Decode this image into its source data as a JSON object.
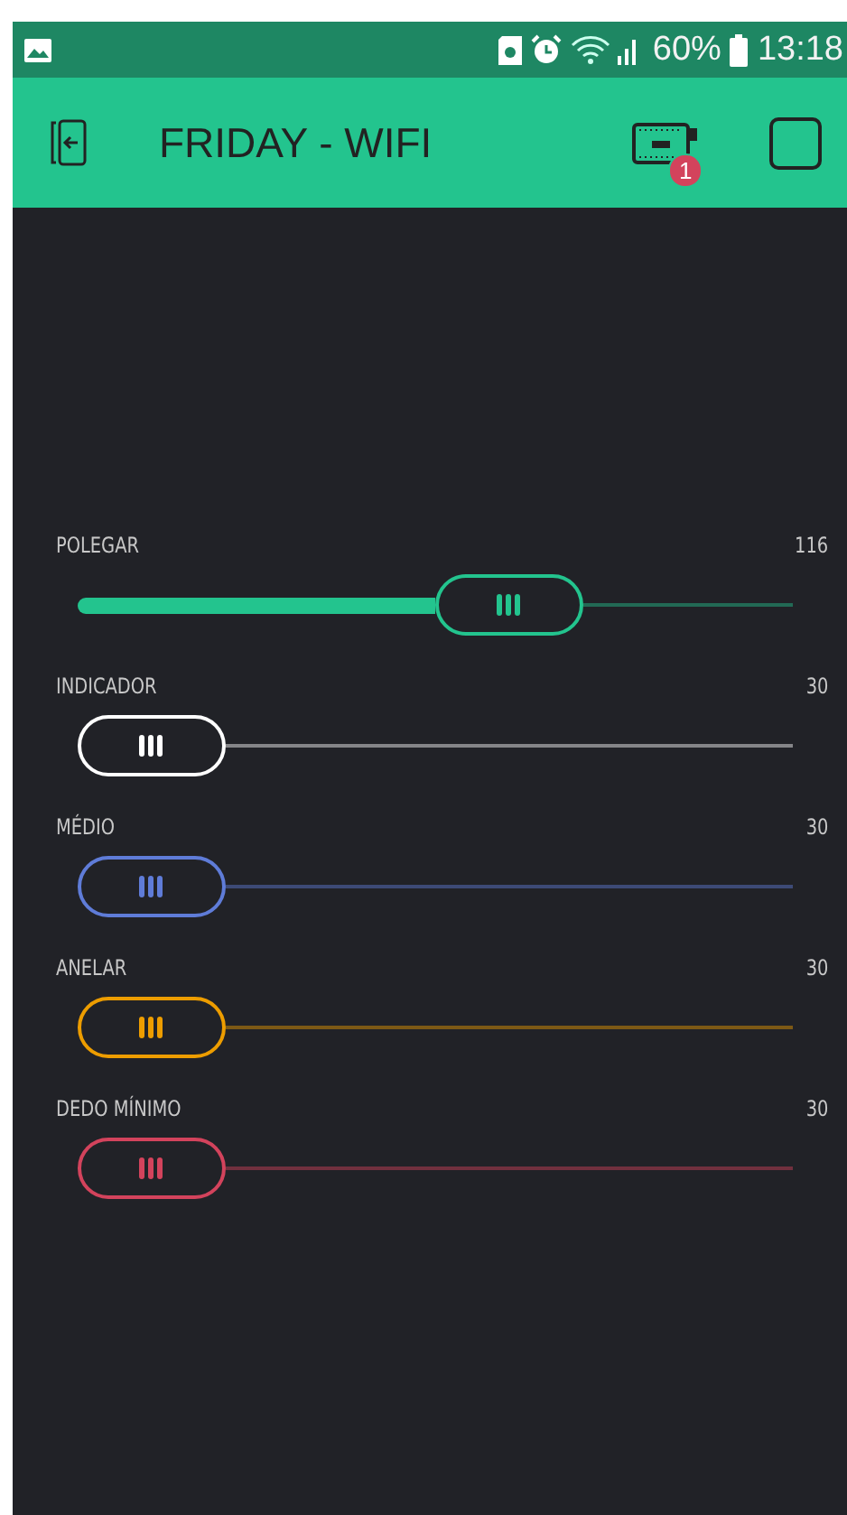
{
  "status_bar": {
    "battery_text": "60%",
    "time": "13:18"
  },
  "header": {
    "title": "FRIDAY - WIFI",
    "badge": "1"
  },
  "sliders": [
    {
      "label": "POLEGAR",
      "reading": "116",
      "level": 0.65,
      "color": "#23c48e"
    },
    {
      "label": "INDICADOR",
      "reading": "30",
      "level": 0,
      "color": "#ffffff"
    },
    {
      "label": "MÉDIO",
      "reading": "30",
      "level": 0,
      "color": "#5f7cd8"
    },
    {
      "label": "ANELAR",
      "reading": "30",
      "level": 0,
      "color": "#ed9d00"
    },
    {
      "label": "DEDO MÍNIMO",
      "reading": "30",
      "level": 0,
      "color": "#d3435c"
    }
  ]
}
